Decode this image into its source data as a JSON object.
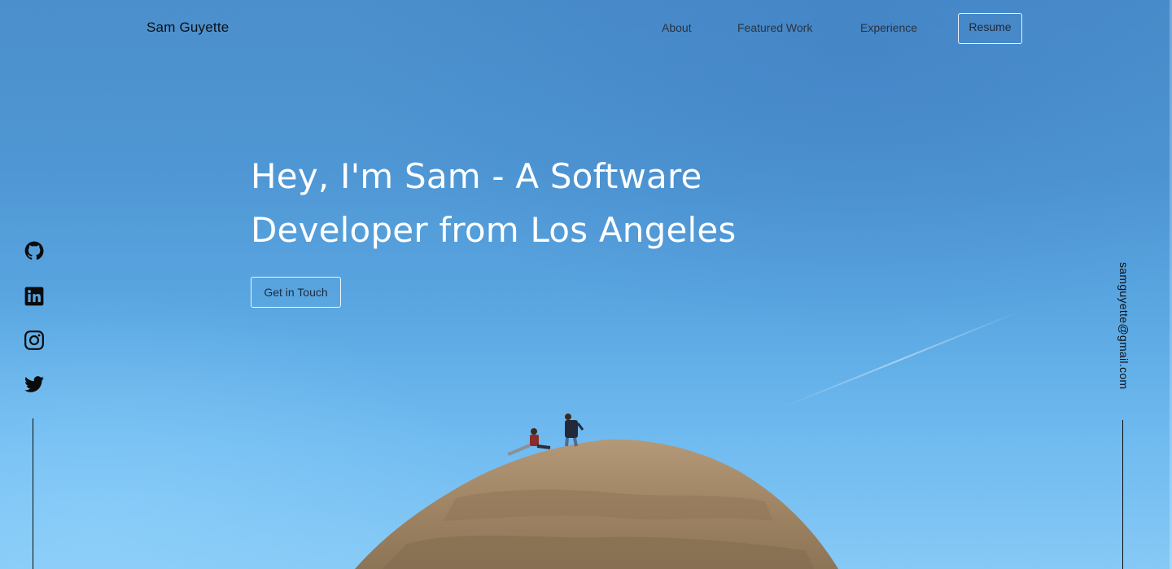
{
  "header": {
    "logo": "Sam Guyette",
    "nav": {
      "about": "About",
      "featured_work": "Featured Work",
      "experience": "Experience",
      "resume": "Resume"
    }
  },
  "hero": {
    "heading_line1": "Hey, I'm Sam - A Software",
    "heading_line2": "Developer from Los Angeles",
    "cta": "Get in Touch"
  },
  "social": {
    "icons": [
      "github-icon",
      "linkedin-icon",
      "instagram-icon",
      "twitter-icon"
    ]
  },
  "contact": {
    "email": "samguyette@gmail.com"
  },
  "colors": {
    "sky_top": "#4b8fcc",
    "sky_bottom": "#86c9f6",
    "text_white": "#ffffff",
    "text_dark": "#0d0f14",
    "rock": "#a48968"
  }
}
